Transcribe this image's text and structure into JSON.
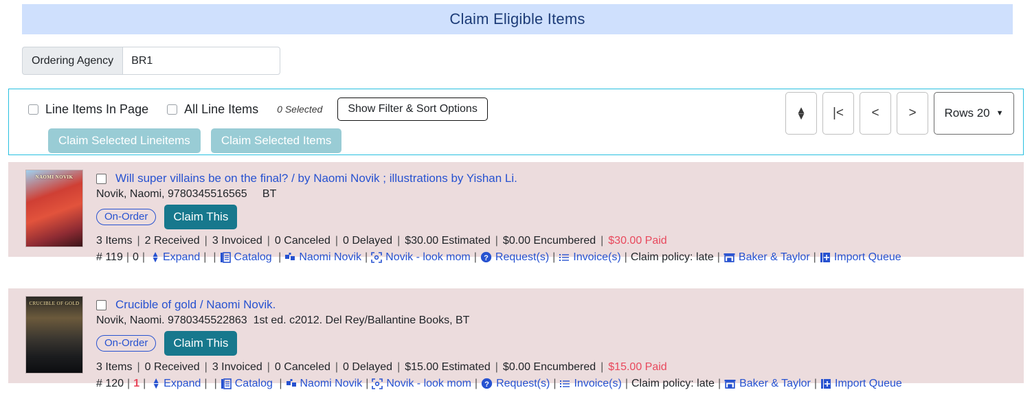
{
  "header": {
    "title": "Claim Eligible Items"
  },
  "filters": {
    "ordering_agency_label": "Ordering Agency",
    "ordering_agency_value": "BR1"
  },
  "toolbar": {
    "line_items_in_page_label": "Line Items In Page",
    "all_line_items_label": "All Line Items",
    "selected_count": "0 Selected",
    "show_filter_sort_label": "Show Filter & Sort Options",
    "claim_selected_lineitems_label": "Claim Selected Lineitems",
    "claim_selected_items_label": "Claim Selected Items",
    "pager": {
      "sort_icon": "up-down-arrows-icon",
      "first_label": "|<",
      "prev_label": "<",
      "next_label": ">",
      "rows_label": "Rows 20",
      "rows_caret": "▼"
    }
  },
  "colors": {
    "banner_bg": "#cfe0fd",
    "banner_text": "#1d3c78",
    "record_bg": "#ecdcdd",
    "toolbar_border": "#27c0e0",
    "claim_button": "#17788d",
    "claim_selected_button": "#99ccd5",
    "link": "#2752d0",
    "paid_red": "#e8485c"
  },
  "records": [
    {
      "cover_alt": "Will super villains be on the final? cover",
      "cover_text": "NAOMI NOVIK",
      "title": "Will super villains be on the final? / by Naomi Novik ; illustrations by Yishan Li.",
      "subtitle": "Novik, Naomi, 9780345516565     BT",
      "status_badge": "On-Order",
      "claim_button_label": "Claim This",
      "stats": [
        {
          "text": "3 Items",
          "style": "normal"
        },
        {
          "text": "2 Received",
          "style": "normal"
        },
        {
          "text": "3 Invoiced",
          "style": "normal"
        },
        {
          "text": "0 Canceled",
          "style": "normal"
        },
        {
          "text": "0 Delayed",
          "style": "normal"
        },
        {
          "text": "$30.00 Estimated",
          "style": "normal"
        },
        {
          "text": "$0.00 Encumbered",
          "style": "normal"
        },
        {
          "text": "$30.00 Paid",
          "style": "paid"
        }
      ],
      "lineitem_number": "# 119",
      "count_badge": "0",
      "count_badge_alert": false,
      "expand_label": "Expand",
      "links": [
        {
          "label": "Catalog",
          "icon": "catalog-icon"
        },
        {
          "label": "Naomi Novik",
          "icon": "vendor-grid-icon"
        },
        {
          "label": "Novik - look mom",
          "icon": "bracket-target-icon"
        },
        {
          "label": "Request(s)",
          "icon": "question-circle-icon"
        },
        {
          "label": "Invoice(s)",
          "icon": "list-lines-icon"
        }
      ],
      "claim_policy": "Claim policy: late",
      "provider_link": {
        "label": "Baker & Taylor",
        "icon": "store-icon"
      },
      "import_queue_link": {
        "label": "Import Queue",
        "icon": "plus-square-icon"
      }
    },
    {
      "cover_alt": "Crucible of gold cover",
      "cover_text": "CRUCIBLE OF GOLD",
      "title": "Crucible of gold / Naomi Novik.",
      "subtitle": "Novik, Naomi. 9780345522863  1st ed. c2012. Del Rey/Ballantine Books, BT",
      "status_badge": "On-Order",
      "claim_button_label": "Claim This",
      "stats": [
        {
          "text": "3 Items",
          "style": "normal"
        },
        {
          "text": "0 Received",
          "style": "normal"
        },
        {
          "text": "3 Invoiced",
          "style": "normal"
        },
        {
          "text": "0 Canceled",
          "style": "normal"
        },
        {
          "text": "0 Delayed",
          "style": "normal"
        },
        {
          "text": "$15.00 Estimated",
          "style": "normal"
        },
        {
          "text": "$0.00 Encumbered",
          "style": "normal"
        },
        {
          "text": "$15.00 Paid",
          "style": "paid"
        }
      ],
      "lineitem_number": "# 120",
      "count_badge": "1",
      "count_badge_alert": true,
      "expand_label": "Expand",
      "links": [
        {
          "label": "Catalog",
          "icon": "catalog-icon"
        },
        {
          "label": "Naomi Novik",
          "icon": "vendor-grid-icon"
        },
        {
          "label": "Novik - look mom",
          "icon": "bracket-target-icon"
        },
        {
          "label": "Request(s)",
          "icon": "question-circle-icon"
        },
        {
          "label": "Invoice(s)",
          "icon": "list-lines-icon"
        }
      ],
      "claim_policy": "Claim policy: late",
      "provider_link": {
        "label": "Baker & Taylor",
        "icon": "store-icon"
      },
      "import_queue_link": {
        "label": "Import Queue",
        "icon": "plus-square-icon"
      }
    }
  ]
}
